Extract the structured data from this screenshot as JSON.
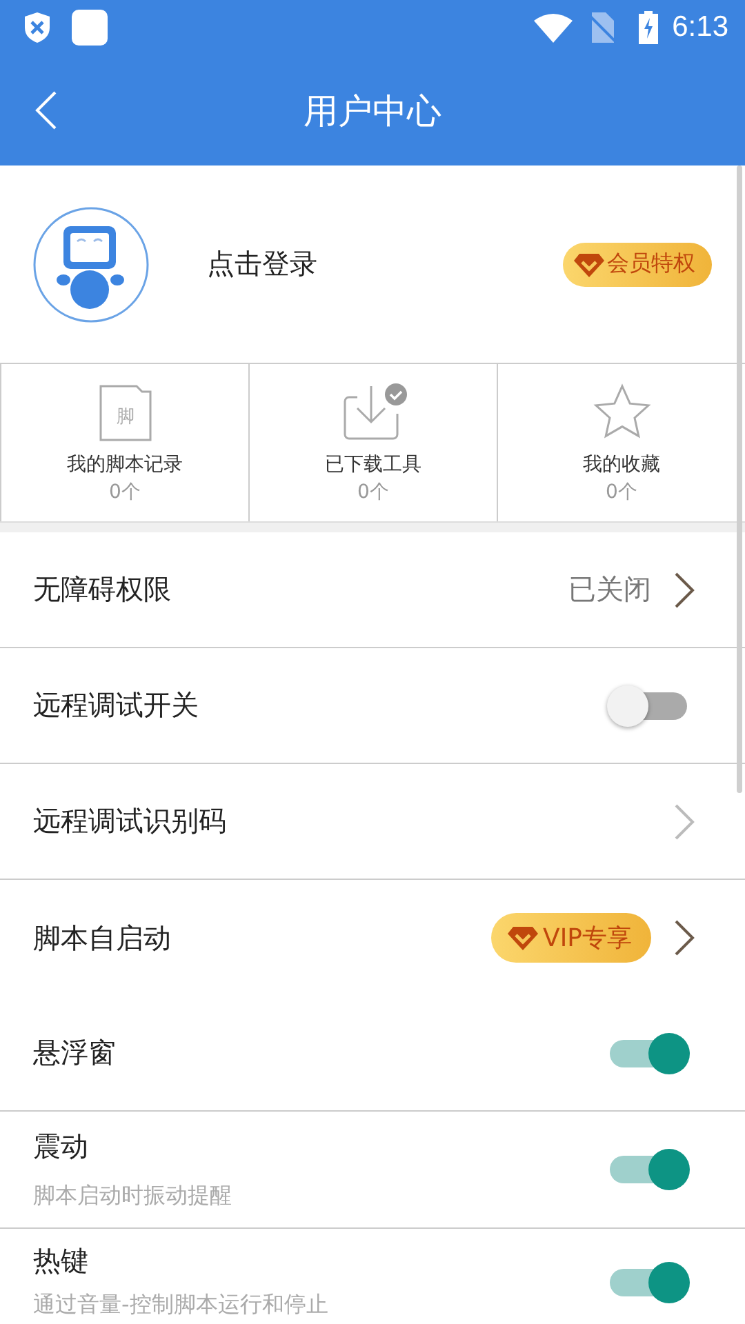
{
  "status_bar": {
    "time": "6:13"
  },
  "header": {
    "title": "用户中心"
  },
  "profile": {
    "login_label": "点击登录",
    "member_badge": "会员特权"
  },
  "stats": [
    {
      "kind": "script",
      "label": "我的脚本记录",
      "count": "0个",
      "icon_text": "脚"
    },
    {
      "kind": "download",
      "label": "已下载工具",
      "count": "0个"
    },
    {
      "kind": "star",
      "label": "我的收藏",
      "count": "0个"
    }
  ],
  "settings": [
    {
      "kind": "link",
      "label": "无障碍权限",
      "value": "已关闭",
      "divider": true,
      "muted_chevron": false
    },
    {
      "kind": "toggle",
      "label": "远程调试开关",
      "on": false,
      "divider": true
    },
    {
      "kind": "link",
      "label": "远程调试识别码",
      "divider": true,
      "muted_chevron": true
    },
    {
      "kind": "vip",
      "label": "脚本自启动",
      "badge": "VIP专享",
      "divider": false
    },
    {
      "kind": "toggle",
      "label": "悬浮窗",
      "on": true,
      "divider": true
    },
    {
      "kind": "toggle",
      "label": "震动",
      "subtitle": "脚本启动时振动提醒",
      "on": true,
      "divider": true
    },
    {
      "kind": "toggle",
      "label": "热键",
      "subtitle": "通过音量-控制脚本运行和停止",
      "on": true,
      "divider": false
    }
  ]
}
